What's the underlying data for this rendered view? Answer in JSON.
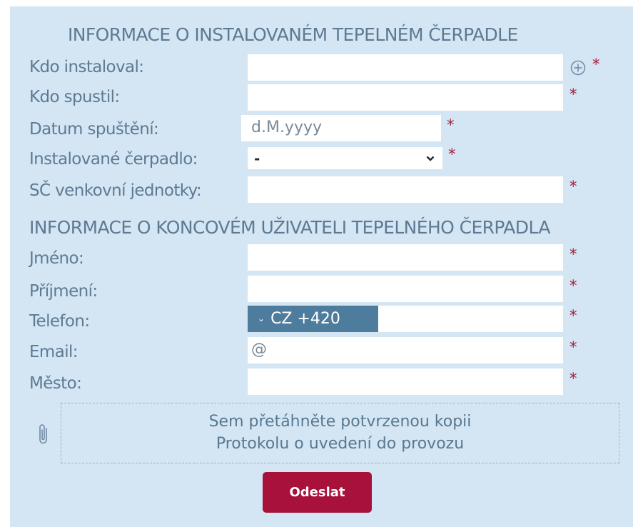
{
  "section_installed": {
    "title": "INFORMACE O INSTALOVANÉM TEPELNÉM ČERPADLE",
    "fields": {
      "installed_by": {
        "label": "Kdo instaloval:",
        "value": "",
        "required_mark": "*"
      },
      "started_by": {
        "label": "Kdo spustil:",
        "value": "",
        "required_mark": "*"
      },
      "start_date": {
        "label": "Datum spuštění:",
        "placeholder": "d.M.yyyy",
        "required_mark": "*"
      },
      "heat_pump": {
        "label": "Instalované čerpadlo:",
        "selected": "-",
        "required_mark": "*"
      },
      "outdoor_serial": {
        "label": "SČ venkovní jednotky:",
        "value": "",
        "required_mark": "*"
      }
    }
  },
  "section_user": {
    "title": "INFORMACE O KONCOVÉM UŽIVATELI TEPELNÉHO ČERPADLA",
    "fields": {
      "first_name": {
        "label": "Jméno:",
        "value": "",
        "required_mark": "*"
      },
      "last_name": {
        "label": "Příjmení:",
        "value": "",
        "required_mark": "*"
      },
      "phone": {
        "label": "Telefon:",
        "country_code": "CZ +420",
        "value": "",
        "required_mark": "*"
      },
      "email": {
        "label": "Email:",
        "placeholder": "@",
        "required_mark": "*"
      },
      "city": {
        "label": "Město:",
        "value": "",
        "required_mark": "*"
      }
    }
  },
  "attachment": {
    "icon": "paperclip-icon",
    "line1": "Sem přetáhněte potvrzenou kopii",
    "line2": "Protokolu o uvedení do provozu"
  },
  "submit_label": "Odeslat",
  "colors": {
    "panel_bg": "#d4e6f4",
    "label_text": "#5e7a92",
    "required": "#a61d3a",
    "country_bg": "#4e7c9c",
    "submit_bg": "#a8123a"
  }
}
